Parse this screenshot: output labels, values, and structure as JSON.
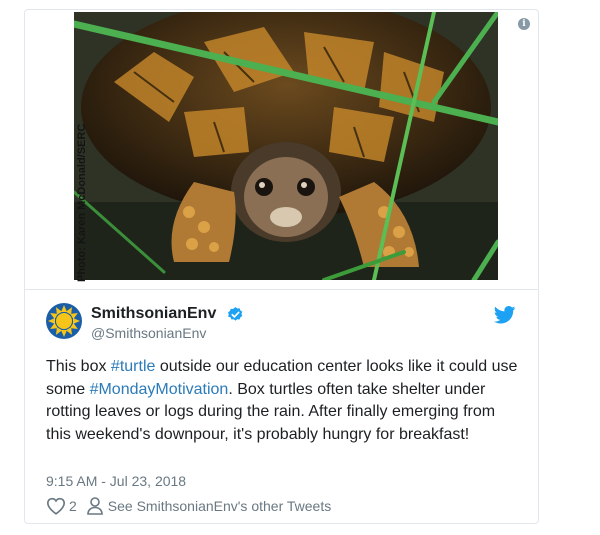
{
  "tweet": {
    "photo_credit": "Photo: Karen McDonald/SERC",
    "author": {
      "name": "SmithsonianEnv",
      "handle": "@SmithsonianEnv"
    },
    "text": {
      "part1": "This box ",
      "hashtag1": "#turtle",
      "part2": " outside our education center looks like it could use some ",
      "hashtag2": "#MondayMotivation",
      "part3": ". Box turtles often take shelter under rotting leaves or logs during the rain. After finally emerging from this weekend's downpour, it's probably hungry for breakfast!"
    },
    "timestamp": "9:15 AM - Jul 23, 2018",
    "likes": "2",
    "profile_link": "See SmithsonianEnv's other Tweets"
  },
  "icons": {
    "info": "info-icon",
    "verified": "verified-badge-icon",
    "bird": "twitter-bird-icon",
    "heart": "heart-icon",
    "person": "person-icon"
  },
  "colors": {
    "link": "#2b7bb9",
    "verified": "#1da1f2",
    "secondary_text": "#697882",
    "avatar_sun": "#f7c519",
    "avatar_bg": "#1b5ea8"
  }
}
